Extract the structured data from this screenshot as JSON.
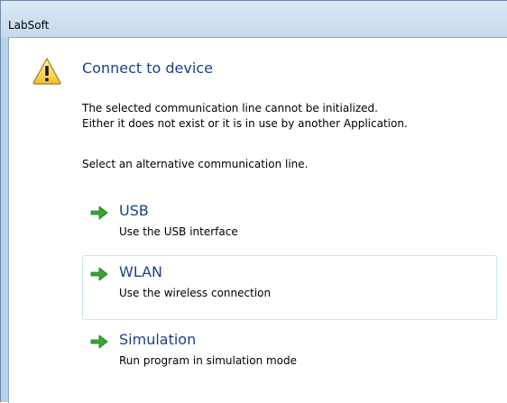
{
  "window": {
    "title": "LabSoft"
  },
  "dialog": {
    "icon": "warning-icon",
    "heading": "Connect to device",
    "message_line1": "The selected communication line cannot be initialized.",
    "message_line2": "Either it does not exist or it is in use by another Application.",
    "prompt": "Select an alternative communication line."
  },
  "options": [
    {
      "title": "USB",
      "description": "Use the USB interface",
      "icon": "green-arrow-icon"
    },
    {
      "title": "WLAN",
      "description": "Use the wireless connection",
      "icon": "green-arrow-icon"
    },
    {
      "title": "Simulation",
      "description": "Run program in simulation mode",
      "icon": "green-arrow-icon"
    }
  ],
  "colors": {
    "heading": "#1e3f8a",
    "arrow": "#3aa336",
    "hover_border": "#cfe3ee",
    "frame": "#b9d1ea"
  }
}
